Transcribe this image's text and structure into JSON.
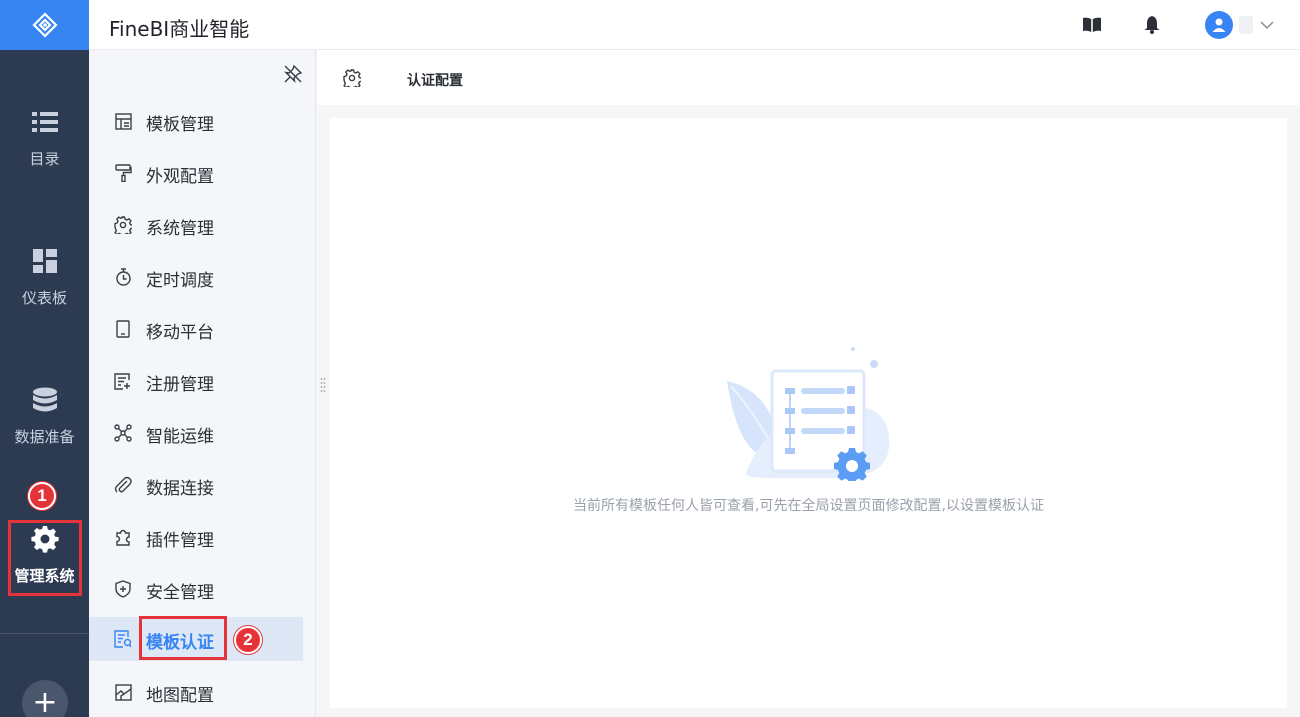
{
  "app": {
    "title": "FineBI商业智能"
  },
  "rail": {
    "items": [
      {
        "label": "目录",
        "icon": "list-icon"
      },
      {
        "label": "仪表板",
        "icon": "dashboard-icon"
      },
      {
        "label": "数据准备",
        "icon": "database-icon"
      },
      {
        "label": "管理系统",
        "icon": "gear-icon",
        "active": true
      }
    ],
    "add_label": "+"
  },
  "header": {
    "icons": [
      "book-icon",
      "bell-icon",
      "user-avatar",
      "chevron-down-icon"
    ]
  },
  "subnav": {
    "items": [
      {
        "label": "模板管理",
        "icon": "template-icon"
      },
      {
        "label": "外观配置",
        "icon": "paint-roller-icon"
      },
      {
        "label": "系统管理",
        "icon": "settings-icon"
      },
      {
        "label": "定时调度",
        "icon": "timer-icon"
      },
      {
        "label": "移动平台",
        "icon": "mobile-icon"
      },
      {
        "label": "注册管理",
        "icon": "register-icon"
      },
      {
        "label": "智能运维",
        "icon": "network-icon"
      },
      {
        "label": "数据连接",
        "icon": "paperclip-icon"
      },
      {
        "label": "插件管理",
        "icon": "puzzle-icon"
      },
      {
        "label": "安全管理",
        "icon": "shield-icon"
      },
      {
        "label": "模板认证",
        "icon": "certificate-icon",
        "active": true
      },
      {
        "label": "地图配置",
        "icon": "map-icon"
      }
    ]
  },
  "content": {
    "title": "认证配置",
    "empty_message": "当前所有模板任何人皆可查看,可先在全局设置页面修改配置,以设置模板认证"
  },
  "annotations": {
    "badge_1": "1",
    "badge_2": "2"
  },
  "colors": {
    "brand": "#3685f2",
    "rail_bg": "#2c3a52",
    "annotation_red": "#e5333a",
    "active_bg": "#dde7f6"
  }
}
